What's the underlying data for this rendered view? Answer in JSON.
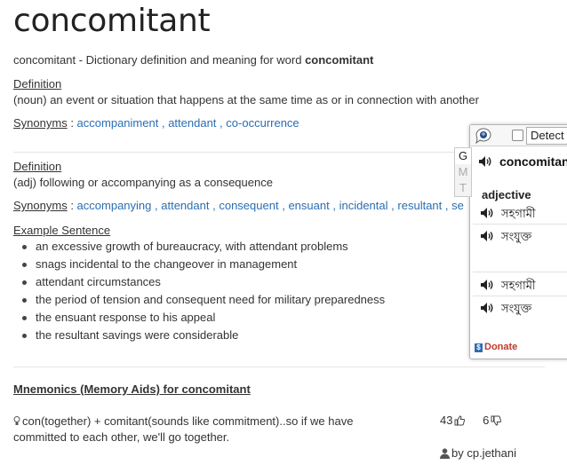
{
  "page": {
    "title": "concomitant",
    "subtitle_prefix": "concomitant - Dictionary definition and meaning for word ",
    "subtitle_word": "concomitant"
  },
  "def1": {
    "heading": "Definition",
    "text": "(noun) an event or situation that happens at the same time as or in connection with another",
    "syn_label": "Synonyms",
    "synonyms": [
      "accompaniment",
      "attendant",
      "co-occurrence"
    ]
  },
  "def2": {
    "heading": "Definition",
    "text": "(adj) following or accompanying as a consequence",
    "syn_label": "Synonyms",
    "synonyms": [
      "accompanying",
      "attendant",
      "consequent",
      "ensuant",
      "incidental",
      "resultant",
      "se"
    ],
    "example_heading": "Example Sentence",
    "examples": [
      "an excessive growth of bureaucracy, with attendant problems",
      "snags incidental to the changeover in management",
      "attendant circumstances",
      "the period of tension and consequent need for military preparedness",
      "the ensuant response to his appeal",
      "the resultant savings were considerable"
    ]
  },
  "mnemonics": {
    "title": "Mnemonics (Memory Aids) for concomitant",
    "text": "con(together) + comitant(sounds like commitment)..so if we have committed to each other, we'll go together.",
    "upvotes": "43",
    "downvotes": "6",
    "author": "by cp.jethani"
  },
  "popup": {
    "detect_label": "Detect",
    "tabs": [
      "G",
      "M",
      "T"
    ],
    "word": "concomitant",
    "pos": "adjective",
    "translations": [
      "সহগামী",
      "সংযুক্ত",
      "সহগামী",
      "সংযুক্ত"
    ],
    "donate": "Donate"
  },
  "colors": {
    "link": "#2a6eb3",
    "donate": "#c0392b"
  }
}
